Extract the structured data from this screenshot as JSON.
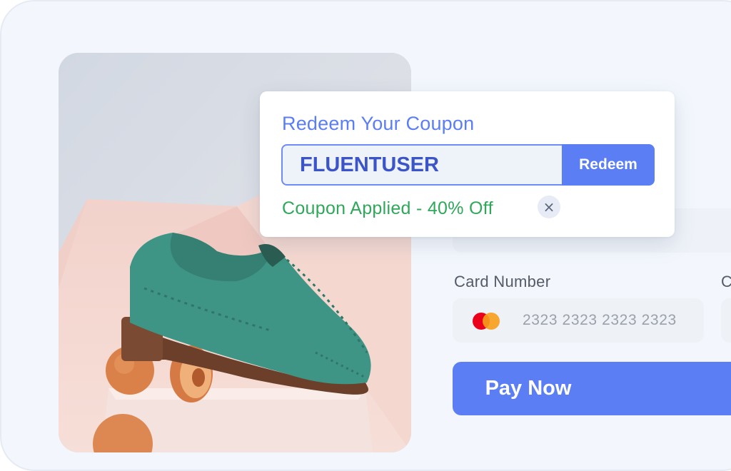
{
  "coupon_popup": {
    "title": "Redeem Your Coupon",
    "code_value": "FLUENTUSER",
    "redeem_label": "Redeem",
    "status_text": "Coupon Applied - 40% Off",
    "remove_icon": "×"
  },
  "payment_form": {
    "card_number_label": "Card Number",
    "cvc_label_partial": "C",
    "card_number_value": "2323 2323 2323 2323",
    "card_brand_icon": "mastercard-icon",
    "pay_label": "Pay Now"
  },
  "colors": {
    "accent": "#5b7ef5",
    "success": "#2fa85a",
    "background": "#f3f7fd"
  }
}
